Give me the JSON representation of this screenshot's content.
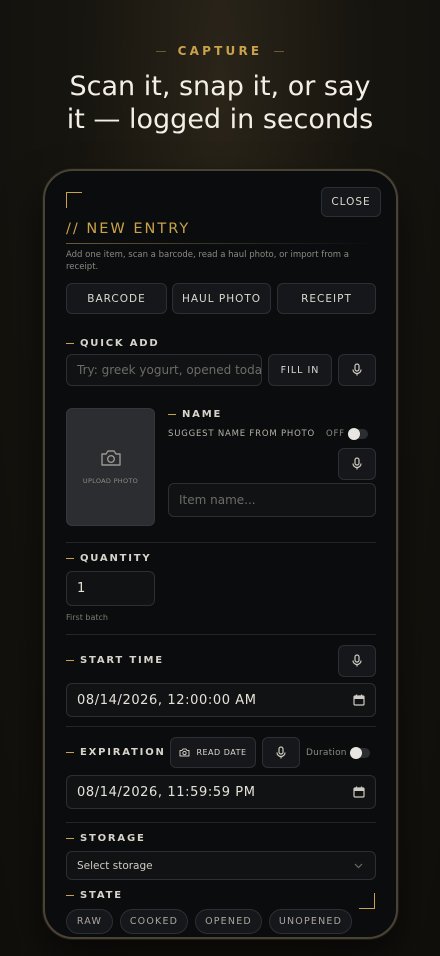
{
  "marketing": {
    "eyebrow": "CAPTURE",
    "headline_line1": "Scan it, snap it, or say",
    "headline_line2": "it — logged in seconds"
  },
  "header": {
    "close_label": "CLOSE",
    "title": "// NEW ENTRY",
    "description": "Add one item, scan a barcode, read a haul photo, or import from a receipt."
  },
  "modes": {
    "barcode": "BARCODE",
    "haul_photo": "HAUL PHOTO",
    "receipt": "RECEIPT"
  },
  "quick_add": {
    "label": "QUICK ADD",
    "placeholder": "Try: greek yogurt, opened today, …",
    "fill_in_label": "FILL IN"
  },
  "photo": {
    "upload_label": "UPLOAD PHOTO"
  },
  "name": {
    "label": "NAME",
    "suggest_label": "SUGGEST NAME FROM PHOTO",
    "suggest_state": "OFF",
    "placeholder": "Item name..."
  },
  "quantity": {
    "label": "QUANTITY",
    "value": "1",
    "hint": "First batch"
  },
  "start_time": {
    "label": "START TIME",
    "value": "08/14/2026, 12:00:00 AM"
  },
  "expiration": {
    "label": "EXPIRATION",
    "read_date_label": "READ DATE",
    "duration_label": "Duration",
    "value": "08/14/2026, 11:59:59 PM"
  },
  "storage": {
    "label": "STORAGE",
    "selected": "Select storage"
  },
  "state": {
    "label": "STATE",
    "options": [
      "RAW",
      "COOKED",
      "OPENED",
      "UNOPENED"
    ]
  },
  "colors": {
    "accent": "#c9a24a",
    "background": "#0b0c0d"
  }
}
